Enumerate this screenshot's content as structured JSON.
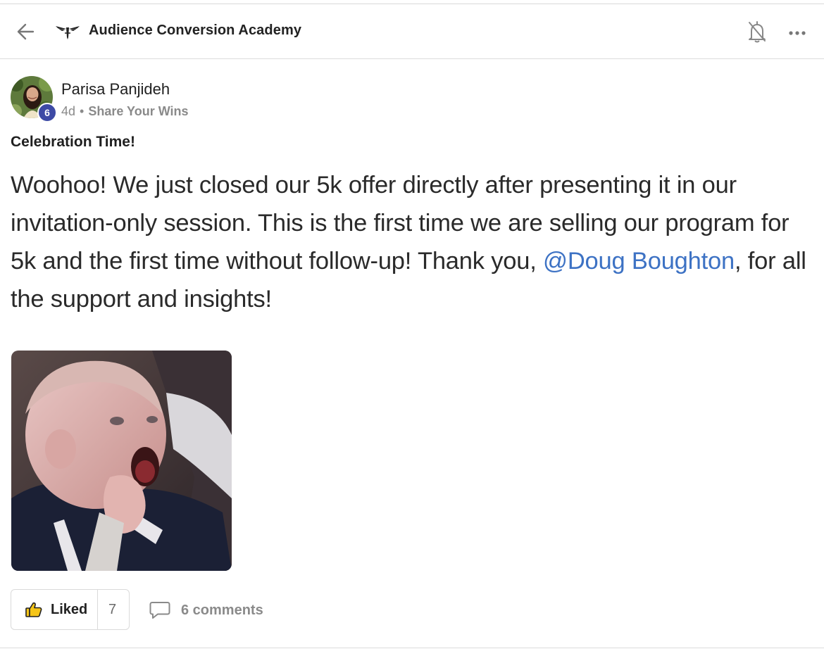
{
  "header": {
    "group_title": "Audience Conversion Academy",
    "back_icon": "arrow-left-icon",
    "logo_icon": "winged-logo-icon",
    "bell_icon": "bell-off-icon",
    "more_icon": "more-horizontal-icon"
  },
  "post": {
    "author": {
      "name": "Parisa Panjideh",
      "level": "6",
      "level_badge_color": "#3d4aa5"
    },
    "time_ago": "4d",
    "separator": "•",
    "category": "Share Your Wins",
    "title": "Celebration Time!",
    "body": {
      "text_before_mention": "Woohoo! We just closed our 5k offer directly after presenting it in our invitation-only session. This is the first time we are selling our program for 5k and the first time without follow-up! Thank you, ",
      "mention": "@Doug Boughton",
      "text_after_mention": ", for all the support and insights!",
      "mention_color": "#3d72c4"
    },
    "image": "animated baby cheering gif"
  },
  "actions": {
    "like_label": "Liked",
    "like_icon": "thumbs-up-icon",
    "like_count": "7",
    "comments_icon": "comment-bubble-icon",
    "comments_label": "6 comments"
  }
}
